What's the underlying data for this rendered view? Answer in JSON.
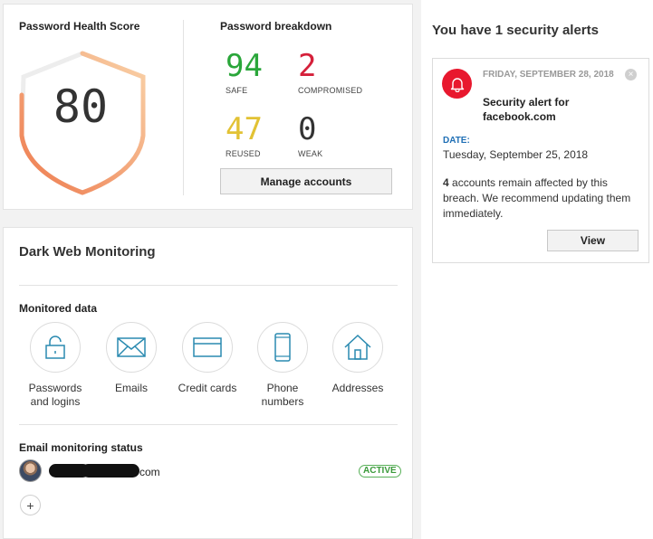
{
  "health": {
    "title": "Password Health Score",
    "score": "80",
    "breakdown_title": "Password breakdown",
    "stats": [
      {
        "value": "94",
        "label": "SAFE",
        "color": "#2aa63a"
      },
      {
        "value": "2",
        "label": "COMPROMISED",
        "color": "#d5203a"
      },
      {
        "value": "47",
        "label": "REUSED",
        "color": "#e2c234"
      },
      {
        "value": "0",
        "label": "WEAK",
        "color": "#333333"
      }
    ],
    "manage_label": "Manage accounts",
    "shield_gradient": [
      "#ee7b4e",
      "#f9d2a8"
    ]
  },
  "darkweb": {
    "title": "Dark Web Monitoring",
    "monitored_title": "Monitored data",
    "items": [
      {
        "icon": "lock-icon",
        "label": "Passwords and logins"
      },
      {
        "icon": "envelope-icon",
        "label": "Emails"
      },
      {
        "icon": "credit-card-icon",
        "label": "Credit cards"
      },
      {
        "icon": "phone-icon",
        "label": "Phone numbers"
      },
      {
        "icon": "house-icon",
        "label": "Addresses"
      }
    ],
    "icon_color": "#2a8ab0",
    "status_title": "Email monitoring status",
    "email_suffix": "com",
    "status_badge": "ACTIVE",
    "add_label": "+"
  },
  "alerts": {
    "title": "You have 1 security alerts",
    "alert": {
      "date": "FRIDAY, SEPTEMBER 28, 2018",
      "heading": "Security alert for facebook.com",
      "date_label": "DATE:",
      "date_value": "Tuesday, September 25, 2018",
      "affected_count": "4",
      "body": " accounts remain affected by this breach. We recommend updating them immediately.",
      "view_label": "View",
      "close_label": "×"
    }
  }
}
